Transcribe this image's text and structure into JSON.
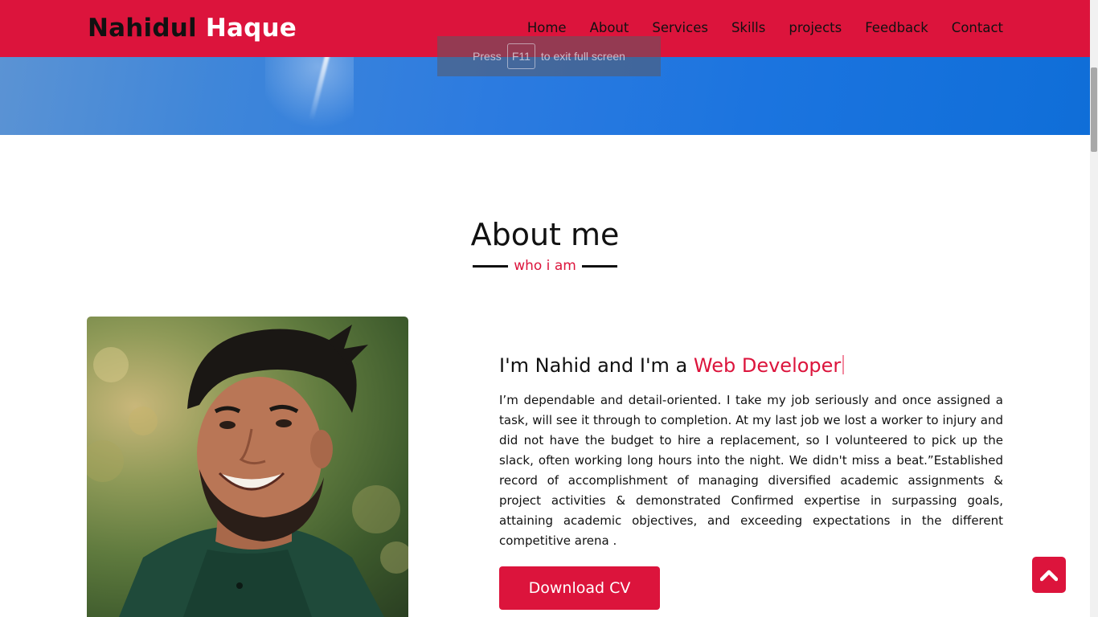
{
  "navbar": {
    "logo_first": "Nahidul",
    "logo_last": "Haque",
    "menu": [
      "Home",
      "About",
      "Services",
      "Skills",
      "projects",
      "Feedback",
      "Contact"
    ],
    "bg_color": "#dc143c"
  },
  "fullscreen_toast": {
    "prefix": "Press",
    "key": "F11",
    "suffix": "to exit full screen"
  },
  "about": {
    "title": "About me",
    "subtitle": "who i am",
    "intro_prefix": "I'm Nahid and I'm a",
    "intro_role": "Web Developer",
    "bio": "I’m dependable and detail-oriented. I take my job seriously and once assigned a task, will see it through to completion. At my last job we lost a worker to injury and did not have the budget to hire a replacement, so I volunteered to pick up the slack, often working long hours into the night. We didn't miss a beat.”Established record of accomplishment of managing diversified academic assignments & project activities & demonstrated Confirmed expertise in surpassing goals, attaining academic objectives, and exceeding expectations in the different competitive arena .",
    "download_label": "Download CV"
  },
  "icons": {
    "scroll_top": "chevron-up-icon"
  },
  "colors": {
    "accent": "#dc143c",
    "sky": "#1b74df"
  }
}
